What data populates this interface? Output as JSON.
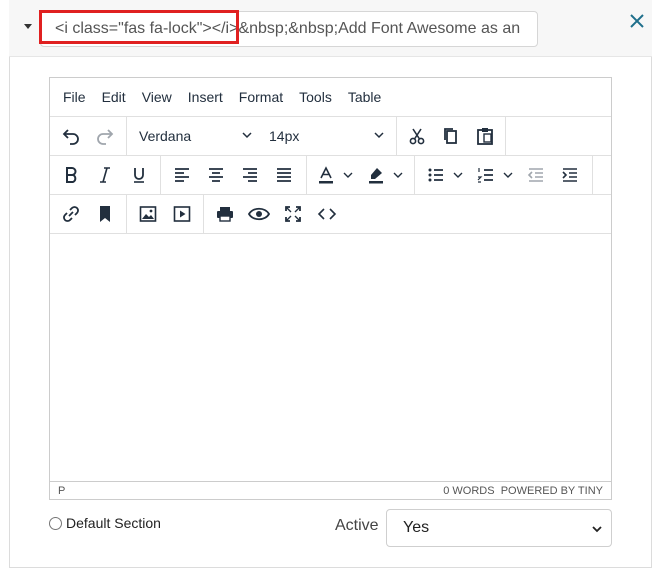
{
  "header": {
    "title_value": "<i class=\"fas fa-lock\"></i>&nbsp;&nbsp;Add Font Awesome as an i"
  },
  "colors": {
    "highlight": "#e02020",
    "close_icon": "#1f6f8b",
    "text": "#222f3e"
  },
  "editor": {
    "menubar": [
      "File",
      "Edit",
      "View",
      "Insert",
      "Format",
      "Tools",
      "Table"
    ],
    "font_family": "Verdana",
    "font_size": "14px",
    "status_path": "P",
    "word_count": "0 WORDS",
    "branding": "POWERED BY TINY"
  },
  "footer": {
    "default_section_label": "Default Section",
    "active_label": "Active",
    "active_value": "Yes"
  }
}
